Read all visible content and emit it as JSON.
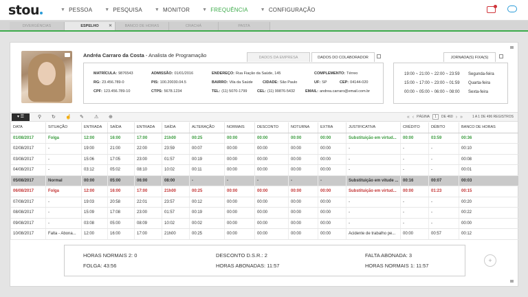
{
  "app": {
    "logo": "stou"
  },
  "nav": {
    "items": [
      {
        "label": "PESSOA",
        "active": false
      },
      {
        "label": "PESQUISA",
        "active": false
      },
      {
        "label": "MONITOR",
        "active": false
      },
      {
        "label": "FREQUÊNCIA",
        "active": true
      },
      {
        "label": "CONFIGURAÇÃO",
        "active": false
      }
    ]
  },
  "subtabs": [
    {
      "label": "DIVERGÊNCIAS",
      "active": false
    },
    {
      "label": "ESPELHO",
      "active": true
    },
    {
      "label": "BANCO DE HORAS",
      "active": false
    },
    {
      "label": "CRACHÁ",
      "active": false
    },
    {
      "label": "PASTA",
      "active": false
    }
  ],
  "employee": {
    "name": "Andréa Carraro da Costa",
    "separator": " - ",
    "role": "Analista de Programação"
  },
  "profile_tabs": {
    "empresa": "DADOS DA EMPRESA",
    "colaborador": "DADOS DO COLABORADOR",
    "jornada": "JORNADA(S) FIXA(S)"
  },
  "info": {
    "matricula": {
      "label": "MATRÍCULA:",
      "value": "9876543"
    },
    "rg": {
      "label": "RG:",
      "value": "23.456.789-0"
    },
    "cpf": {
      "label": "CPF:",
      "value": "123.456.789-10"
    },
    "admissao": {
      "label": "ADMISSÃO:",
      "value": "01/01/2016"
    },
    "pis": {
      "label": "PIS:",
      "value": "100.20030.04.5"
    },
    "ctps": {
      "label": "CTPS:",
      "value": "5678.1234"
    },
    "endereco": {
      "label": "ENDEREÇO:",
      "value": "Rua Fiação da Saúde, 145"
    },
    "bairro": {
      "label": "BAIRRO:",
      "value": "Vila da Saúde"
    },
    "cidade": {
      "label": "CIDADE:",
      "value": "São Paulo"
    },
    "tel": {
      "label": "TEL:",
      "value": "(11) 5070-1799"
    },
    "cel": {
      "label": "CEL:",
      "value": "(11) 99876-5432"
    },
    "email": {
      "label": "EMAIL:",
      "value": "andrea.carraro@email.com.br"
    },
    "complemento": {
      "label": "COMPLEMENTO:",
      "value": "Térreo"
    },
    "uf": {
      "label": "UF:",
      "value": "SP"
    },
    "cep": {
      "label": "CEP:",
      "value": "04144-020"
    }
  },
  "jornadas": [
    {
      "hours": "19:00 ~ 21:00 ~ 22:00 ~ 23:59",
      "day": "Segunda-feira"
    },
    {
      "hours": "15:00 ~ 17:00 ~ 23:00 ~ 01:59",
      "day": "Quarta-feira"
    },
    {
      "hours": "00:00 ~ 05:00 ~ 06:00 ~ 08:00",
      "day": "Sexta-feira"
    }
  ],
  "pager": {
    "label": "PÁGINA",
    "current": "1",
    "of": "DE 460",
    "records": "1 A 1 DE 496 REGISTROS"
  },
  "table": {
    "headers": [
      "DATA",
      "SITUAÇÃO",
      "ENTRADA",
      "SAÍDA",
      "ENTRADA",
      "SAÍDA",
      "ALTERAÇÃO",
      "NORMAIS",
      "DESCONTO",
      "NOTURNA",
      "EXTRA",
      "JUSTIFICATIVA",
      "CRÉDITO",
      "DÉBITO",
      "BANCO DE HORAS"
    ],
    "rows": [
      {
        "style": "green",
        "cells": [
          "01/08/2017",
          "Folga",
          "12:00",
          "16:00",
          "17:00",
          "21h00",
          "00:25",
          "00:00",
          "00:00",
          "00:00",
          "00:00",
          "Substituição em virtud...",
          "00:00",
          "03:59",
          "00:36"
        ]
      },
      {
        "style": "",
        "cells": [
          "02/08/2017",
          "-",
          "19:00",
          "21:00",
          "22:00",
          "23:59",
          "00:07",
          "00:00",
          "00:00",
          "00:00",
          "00:00",
          "-",
          "-",
          "-",
          "00:10"
        ]
      },
      {
        "style": "",
        "cells": [
          "03/08/2017",
          "-",
          "15:06",
          "17:05",
          "23:00",
          "01:57",
          "00:19",
          "00:00",
          "00:00",
          "00:00",
          "00:00",
          "-",
          "-",
          "-",
          "00:08"
        ]
      },
      {
        "style": "",
        "cells": [
          "04/08/2017",
          "-",
          "03:12",
          "05:02",
          "08:10",
          "10:02",
          "00:11",
          "00:00",
          "00:00",
          "00:00",
          "00:00",
          "-",
          "-",
          "-",
          "00:01"
        ]
      },
      {
        "style": "gray",
        "cells": [
          "05/08/2017",
          "Normal",
          "00:00",
          "05:00",
          "06:00",
          "08:00",
          "-",
          "-",
          "-",
          "-",
          "-",
          "Substituição em vitude ...",
          "00:16",
          "00:07",
          "00:03"
        ]
      },
      {
        "style": "red",
        "cells": [
          "06/08/2017",
          "Folga",
          "12:00",
          "16:00",
          "17:00",
          "21h00",
          "00:25",
          "00:00",
          "00:00",
          "00:00",
          "00:00",
          "Substituição em virtud...",
          "00:00",
          "01:23",
          "00:15"
        ]
      },
      {
        "style": "",
        "cells": [
          "07/08/2017",
          "-",
          "19:03",
          "20:58",
          "22:01",
          "23:57",
          "00:12",
          "00:00",
          "00:00",
          "00:00",
          "00:00",
          "-",
          "-",
          "-",
          "00:20"
        ]
      },
      {
        "style": "",
        "cells": [
          "08/08/2017",
          "-",
          "15:09",
          "17:08",
          "23:00",
          "01:57",
          "00:19",
          "00:00",
          "00:00",
          "00:00",
          "00:00",
          "-",
          "-",
          "-",
          "00:22"
        ]
      },
      {
        "style": "",
        "cells": [
          "09/08/2017",
          "-",
          "03:08",
          "05:00",
          "08:09",
          "10:02",
          "00:02",
          "00:00",
          "00:00",
          "00:00",
          "00:00",
          "-",
          "-",
          "-",
          "00:00"
        ]
      },
      {
        "style": "",
        "cells": [
          "10/08/2017",
          "Falta - Abona...",
          "12:00",
          "16:00",
          "17:00",
          "21h00",
          "00:25",
          "00:00",
          "00:00",
          "00:00",
          "00:00",
          "Acidente de trabalho pe...",
          "00:00",
          "00:57",
          "00:12"
        ]
      }
    ]
  },
  "summary": {
    "horas_normais_2": {
      "label": "HORAS NORMAIS 2:",
      "value": "0"
    },
    "folga": {
      "label": "FOLGA:",
      "value": "43:56"
    },
    "desconto_dsr": {
      "label": "DESCONTO D.S.R.:",
      "value": "2"
    },
    "horas_abonadas": {
      "label": "HORAS ABONADAS:",
      "value": "11:57"
    },
    "falta_abonada": {
      "label": "FALTA ABONADA:",
      "value": "3"
    },
    "horas_normais_1": {
      "label": "HORAS NORMAIS 1:",
      "value": "11:57"
    }
  },
  "icons": [
    "chevron-down-icon",
    "list-icon",
    "search-icon",
    "refresh-icon",
    "thumb-up-icon",
    "comment-icon",
    "warning-icon",
    "add-icon",
    "first-page-icon",
    "prev-page-icon",
    "next-page-icon",
    "last-page-icon",
    "camera-icon",
    "external-link-icon",
    "notification-icon",
    "cloud-icon"
  ],
  "colors": {
    "accent_green": "#3cab4a",
    "alert_red": "#c33535",
    "brand_blue": "#2a9bd8"
  }
}
